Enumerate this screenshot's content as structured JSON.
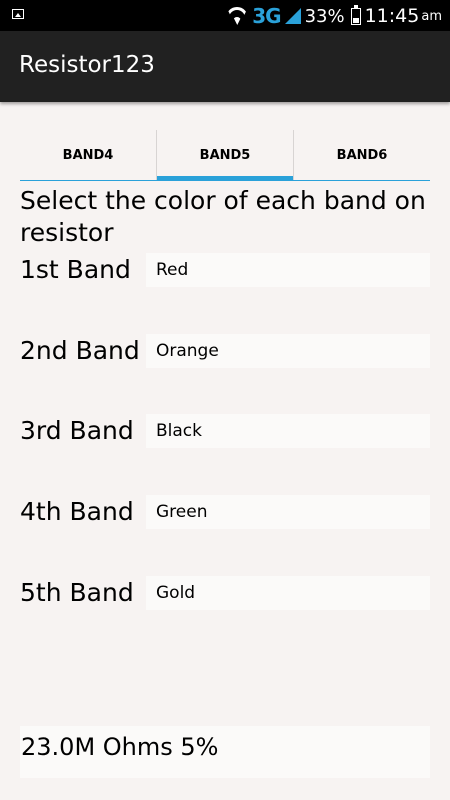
{
  "status_bar": {
    "network": "3G",
    "battery": "33%",
    "time": "11:45",
    "ampm": "am",
    "icons": [
      "image-icon",
      "wifi-icon",
      "signal-icon",
      "battery-icon"
    ]
  },
  "app": {
    "title": "Resistor123"
  },
  "tabs": [
    {
      "label": "BAND4",
      "active": false
    },
    {
      "label": "BAND5",
      "active": true
    },
    {
      "label": "BAND6",
      "active": false
    }
  ],
  "instruction": "Select the color of each band on resistor",
  "bands": [
    {
      "label": "1st Band",
      "value": "Red"
    },
    {
      "label": "2nd Band",
      "value": "Orange"
    },
    {
      "label": "3rd Band",
      "value": "Black"
    },
    {
      "label": "4th Band",
      "value": "Green"
    },
    {
      "label": "5th Band",
      "value": "Gold"
    }
  ],
  "result": "23.0M Ohms 5%",
  "colors": {
    "accent": "#2aa1d9",
    "action_bar": "#212121",
    "background": "#f7f3f2"
  }
}
